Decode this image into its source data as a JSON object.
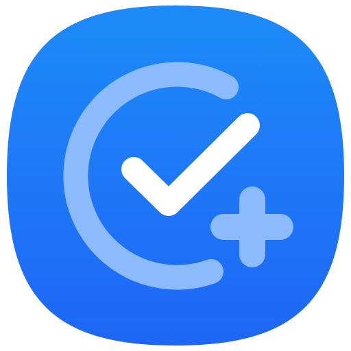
{
  "app_icon": {
    "background_gradient": [
      "#1D8BF8",
      "#1E66F5"
    ],
    "ring_color": "#8BBBFD",
    "check_color": "#FFFFFF",
    "plus_color": "#8BBBFD",
    "glyphs": [
      "arc-ring-icon",
      "checkmark-icon",
      "plus-icon"
    ]
  }
}
